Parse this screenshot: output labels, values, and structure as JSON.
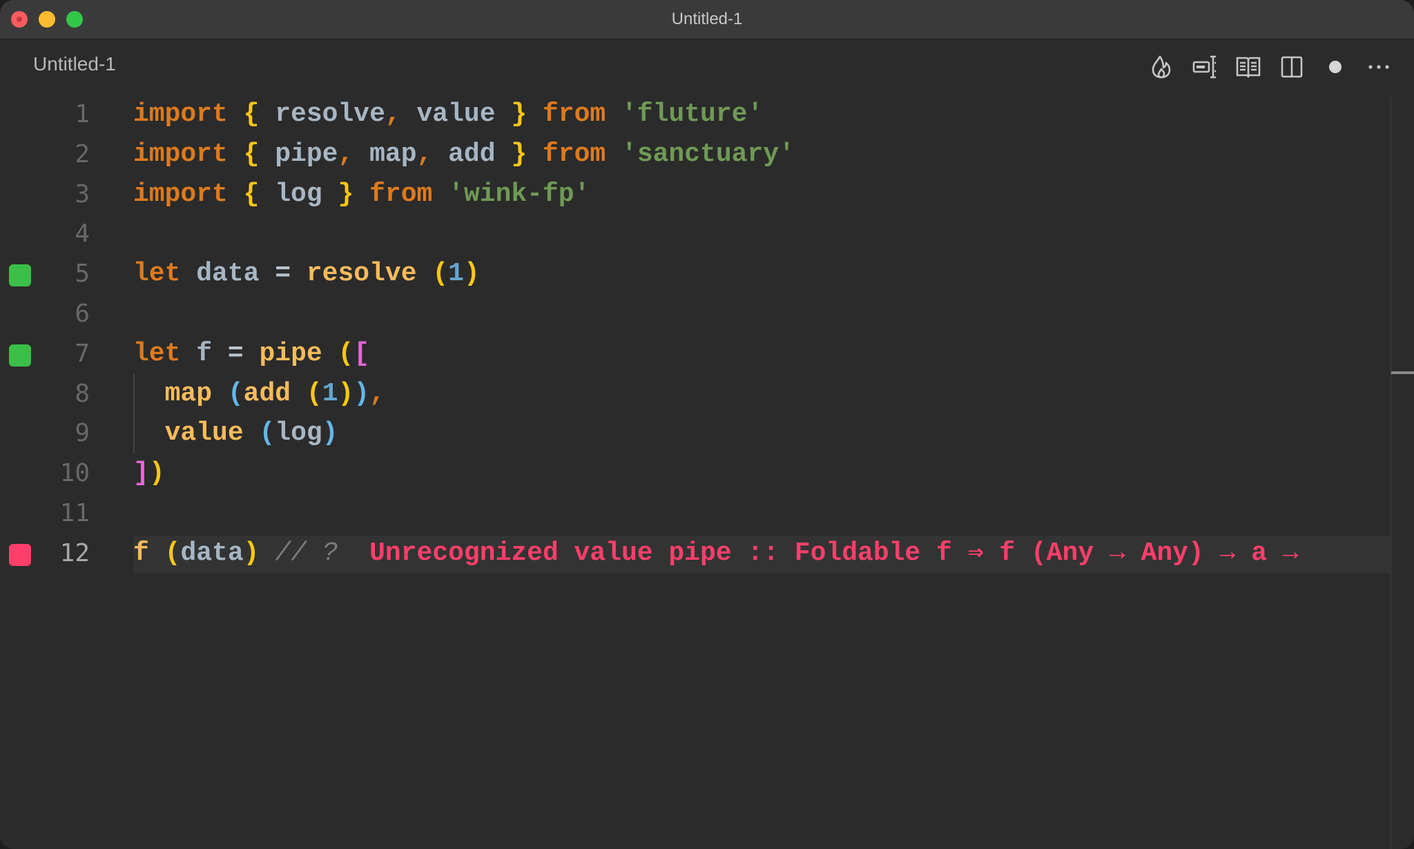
{
  "window": {
    "title": "Untitled-1",
    "traffic_lights": [
      "close",
      "minimize",
      "maximize"
    ]
  },
  "tab": {
    "title": "Untitled-1"
  },
  "actions": [
    {
      "name": "flame-icon",
      "label": "Quokka"
    },
    {
      "name": "text-cursor-icon",
      "label": "Toggle"
    },
    {
      "name": "open-preview-icon",
      "label": "Open Preview"
    },
    {
      "name": "split-editor-icon",
      "label": "Split Editor"
    },
    {
      "name": "unsaved-dot-icon",
      "label": "Unsaved"
    },
    {
      "name": "more-actions-icon",
      "label": "More Actions"
    }
  ],
  "colors": {
    "keyword": "#de7a1e",
    "string": "#6f9a55",
    "function": "#f8bb5b",
    "identifier": "#a7b6c4",
    "error": "#fd3f6a",
    "success": "#3bbf48"
  },
  "lines": [
    {
      "n": "1",
      "status": "",
      "tokens": [
        [
          "kw",
          "import"
        ],
        [
          "ident",
          " "
        ],
        [
          "brace1",
          "{"
        ],
        [
          "ident",
          " resolve"
        ],
        [
          "punct",
          ","
        ],
        [
          "ident",
          " value "
        ],
        [
          "brace1",
          "}"
        ],
        [
          "ident",
          " "
        ],
        [
          "kw",
          "from"
        ],
        [
          "ident",
          " "
        ],
        [
          "str",
          "'fluture'"
        ]
      ]
    },
    {
      "n": "2",
      "status": "",
      "tokens": [
        [
          "kw",
          "import"
        ],
        [
          "ident",
          " "
        ],
        [
          "brace1",
          "{"
        ],
        [
          "ident",
          " pipe"
        ],
        [
          "punct",
          ","
        ],
        [
          "ident",
          " map"
        ],
        [
          "punct",
          ","
        ],
        [
          "ident",
          " add "
        ],
        [
          "brace1",
          "}"
        ],
        [
          "ident",
          " "
        ],
        [
          "kw",
          "from"
        ],
        [
          "ident",
          " "
        ],
        [
          "str",
          "'sanctuary'"
        ]
      ]
    },
    {
      "n": "3",
      "status": "",
      "tokens": [
        [
          "kw",
          "import"
        ],
        [
          "ident",
          " "
        ],
        [
          "brace1",
          "{"
        ],
        [
          "ident",
          " log "
        ],
        [
          "brace1",
          "}"
        ],
        [
          "ident",
          " "
        ],
        [
          "kw",
          "from"
        ],
        [
          "ident",
          " "
        ],
        [
          "str",
          "'wink-fp'"
        ]
      ]
    },
    {
      "n": "4",
      "status": "",
      "tokens": []
    },
    {
      "n": "5",
      "status": "ok",
      "tokens": [
        [
          "kw",
          "let"
        ],
        [
          "ident",
          " data "
        ],
        [
          "op",
          "="
        ],
        [
          "ident",
          " "
        ],
        [
          "fn",
          "resolve"
        ],
        [
          "ident",
          " "
        ],
        [
          "brace1",
          "("
        ],
        [
          "num-lit",
          "1"
        ],
        [
          "brace1",
          ")"
        ]
      ]
    },
    {
      "n": "6",
      "status": "",
      "tokens": []
    },
    {
      "n": "7",
      "status": "ok",
      "tokens": [
        [
          "kw",
          "let"
        ],
        [
          "ident",
          " f "
        ],
        [
          "op",
          "="
        ],
        [
          "ident",
          " "
        ],
        [
          "fn",
          "pipe"
        ],
        [
          "ident",
          " "
        ],
        [
          "brace1",
          "("
        ],
        [
          "brace2",
          "["
        ]
      ]
    },
    {
      "n": "8",
      "status": "",
      "indent": true,
      "tokens": [
        [
          "ident",
          "  "
        ],
        [
          "fn",
          "map"
        ],
        [
          "ident",
          " "
        ],
        [
          "brace3",
          "("
        ],
        [
          "fn",
          "add"
        ],
        [
          "ident",
          " "
        ],
        [
          "brace1",
          "("
        ],
        [
          "num-lit",
          "1"
        ],
        [
          "brace1",
          ")"
        ],
        [
          "brace3",
          ")"
        ],
        [
          "punct",
          ","
        ]
      ]
    },
    {
      "n": "9",
      "status": "",
      "indent": true,
      "tokens": [
        [
          "ident",
          "  "
        ],
        [
          "fn",
          "value"
        ],
        [
          "ident",
          " "
        ],
        [
          "brace3",
          "("
        ],
        [
          "ident",
          "log"
        ],
        [
          "brace3",
          ")"
        ]
      ]
    },
    {
      "n": "10",
      "status": "",
      "tokens": [
        [
          "brace2",
          "]"
        ],
        [
          "brace1",
          ")"
        ]
      ]
    },
    {
      "n": "11",
      "status": "",
      "tokens": []
    },
    {
      "n": "12",
      "status": "err",
      "active": true,
      "tokens": [
        [
          "fn",
          "f"
        ],
        [
          "ident",
          " "
        ],
        [
          "brace1",
          "("
        ],
        [
          "ident",
          "data"
        ],
        [
          "brace1",
          ")"
        ],
        [
          "ident",
          " "
        ],
        [
          "comment",
          "// ?  "
        ],
        [
          "err-msg",
          "Unrecognized value pipe :: Foldable f ⇒ f (Any → Any) → a →"
        ]
      ]
    }
  ]
}
